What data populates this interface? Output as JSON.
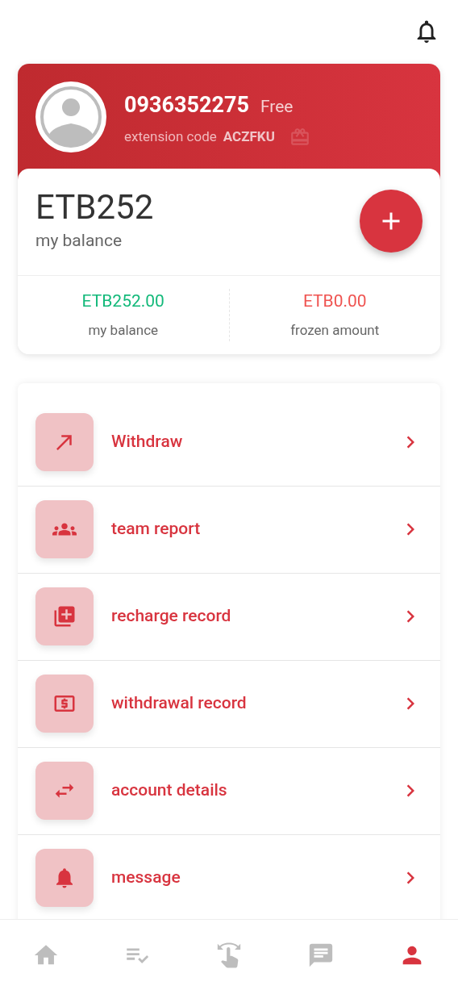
{
  "profile": {
    "phone": "0936352275",
    "level": "Free",
    "extension_label": "extension code",
    "extension_code": "ACZFKU"
  },
  "balance": {
    "amount": "ETB252",
    "label": "my balance"
  },
  "stats": [
    {
      "kind": "positive",
      "value": "ETB252.00",
      "label": "my balance"
    },
    {
      "kind": "negative",
      "value": "ETB0.00",
      "label": "frozen amount"
    }
  ],
  "menu": [
    {
      "kind": "withdraw",
      "label": "Withdraw"
    },
    {
      "kind": "team",
      "label": "team report"
    },
    {
      "kind": "recharge",
      "label": "recharge record"
    },
    {
      "kind": "withdrawal",
      "label": "withdrawal record"
    },
    {
      "kind": "transfer",
      "label": "account details"
    },
    {
      "kind": "bell",
      "label": "message"
    }
  ],
  "nav": [
    {
      "kind": "home",
      "selected": false
    },
    {
      "kind": "tasks",
      "selected": false
    },
    {
      "kind": "swipe",
      "selected": false
    },
    {
      "kind": "chat",
      "selected": false
    },
    {
      "kind": "person",
      "selected": true
    }
  ]
}
